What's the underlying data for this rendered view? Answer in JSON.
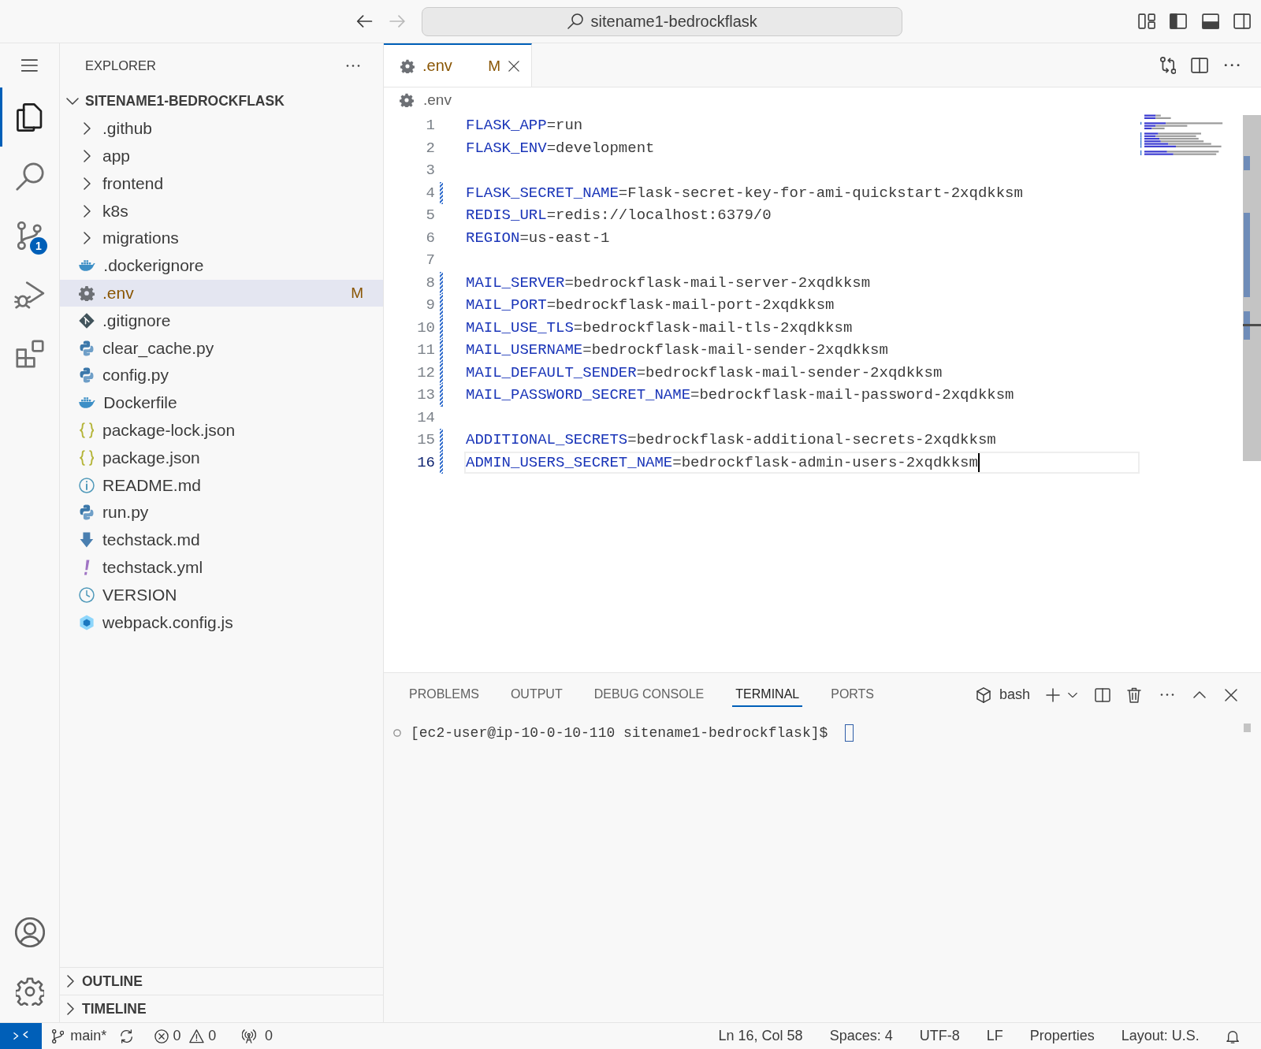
{
  "title_bar": {
    "nav": [
      {
        "kind": "back",
        "disabled": false
      },
      {
        "kind": "forward",
        "disabled": true
      }
    ],
    "search": "sitename1-bedrockflask",
    "layout_toggles": [
      {
        "kind": "primary-sidebar",
        "on": true
      },
      {
        "kind": "panel",
        "on": true
      },
      {
        "kind": "secondary-sidebar",
        "on": false
      }
    ]
  },
  "activity_bar": {
    "items": [
      {
        "kind": "explorer",
        "selected": true
      },
      {
        "kind": "search",
        "selected": false
      },
      {
        "kind": "source-control",
        "selected": false,
        "badge": "1"
      },
      {
        "kind": "run-debug",
        "selected": false
      },
      {
        "kind": "extensions",
        "selected": false
      }
    ]
  },
  "sidebar": {
    "title": "EXPLORER",
    "root": {
      "name": "SITENAME1-BEDROCKFLASK",
      "expanded": true,
      "children": [
        {
          "name": ".github",
          "kind": "folder",
          "expanded": false,
          "selected": false,
          "modified": false
        },
        {
          "name": "app",
          "kind": "folder",
          "expanded": false,
          "selected": false,
          "modified": false
        },
        {
          "name": "frontend",
          "kind": "folder",
          "expanded": false,
          "selected": false,
          "modified": false
        },
        {
          "name": "k8s",
          "kind": "folder",
          "expanded": false,
          "selected": false,
          "modified": false
        },
        {
          "name": "migrations",
          "kind": "folder",
          "expanded": false,
          "selected": false,
          "modified": false
        },
        {
          "name": ".dockerignore",
          "kind": "docker",
          "selected": false,
          "modified": false
        },
        {
          "name": ".env",
          "kind": "config",
          "selected": true,
          "modified": true,
          "badge": "M"
        },
        {
          "name": ".gitignore",
          "kind": "git",
          "selected": false,
          "modified": false
        },
        {
          "name": "clear_cache.py",
          "kind": "python",
          "selected": false,
          "modified": false
        },
        {
          "name": "config.py",
          "kind": "python",
          "selected": false,
          "modified": false
        },
        {
          "name": "Dockerfile",
          "kind": "docker",
          "selected": false,
          "modified": false
        },
        {
          "name": "package-lock.json",
          "kind": "json",
          "selected": false,
          "modified": false
        },
        {
          "name": "package.json",
          "kind": "json",
          "selected": false,
          "modified": false
        },
        {
          "name": "README.md",
          "kind": "info",
          "selected": false,
          "modified": false
        },
        {
          "name": "run.py",
          "kind": "python",
          "selected": false,
          "modified": false
        },
        {
          "name": "techstack.md",
          "kind": "markdown",
          "selected": false,
          "modified": false
        },
        {
          "name": "techstack.yml",
          "kind": "yaml",
          "selected": false,
          "modified": false
        },
        {
          "name": "VERSION",
          "kind": "version",
          "selected": false,
          "modified": false
        },
        {
          "name": "webpack.config.js",
          "kind": "webpack",
          "selected": false,
          "modified": false
        }
      ]
    },
    "sections": [
      {
        "title": "OUTLINE",
        "expanded": false
      },
      {
        "title": "TIMELINE",
        "expanded": false
      }
    ]
  },
  "editor": {
    "tabs": [
      {
        "label": ".env",
        "kind": "config",
        "badge": "M",
        "modified": true,
        "selected": true
      }
    ],
    "breadcrumb": [
      {
        "label": ".env",
        "kind": "config"
      }
    ],
    "lines": [
      {
        "number": "1",
        "key": "FLASK_APP",
        "value": "=run",
        "modified": false,
        "current": false
      },
      {
        "number": "2",
        "key": "FLASK_ENV",
        "value": "=development",
        "modified": false,
        "current": false
      },
      {
        "number": "3",
        "modified": false,
        "current": false
      },
      {
        "number": "4",
        "key": "FLASK_SECRET_NAME",
        "value": "=Flask-secret-key-for-ami-quickstart-2xqdkksm",
        "modified": true,
        "current": false
      },
      {
        "number": "5",
        "key": "REDIS_URL",
        "value": "=redis://localhost:6379/0",
        "modified": false,
        "current": false
      },
      {
        "number": "6",
        "key": "REGION",
        "value": "=us-east-1",
        "modified": false,
        "current": false
      },
      {
        "number": "7",
        "modified": false,
        "current": false
      },
      {
        "number": "8",
        "key": "MAIL_SERVER",
        "value": "=bedrockflask-mail-server-2xqdkksm",
        "modified": true,
        "current": false
      },
      {
        "number": "9",
        "key": "MAIL_PORT",
        "value": "=bedrockflask-mail-port-2xqdkksm",
        "modified": true,
        "current": false
      },
      {
        "number": "10",
        "key": "MAIL_USE_TLS",
        "value": "=bedrockflask-mail-tls-2xqdkksm",
        "modified": true,
        "current": false
      },
      {
        "number": "11",
        "key": "MAIL_USERNAME",
        "value": "=bedrockflask-mail-sender-2xqdkksm",
        "modified": true,
        "current": false
      },
      {
        "number": "12",
        "key": "MAIL_DEFAULT_SENDER",
        "value": "=bedrockflask-mail-sender-2xqdkksm",
        "modified": true,
        "current": false
      },
      {
        "number": "13",
        "key": "MAIL_PASSWORD_SECRET_NAME",
        "value": "=bedrockflask-mail-password-2xqdkksm",
        "modified": true,
        "current": false
      },
      {
        "number": "14",
        "modified": false,
        "current": false
      },
      {
        "number": "15",
        "key": "ADDITIONAL_SECRETS",
        "value": "=bedrockflask-additional-secrets-2xqdkksm",
        "modified": true,
        "current": false
      },
      {
        "number": "16",
        "key": "ADMIN_USERS_SECRET_NAME",
        "value": "=bedrockflask-admin-users-2xqdkksm",
        "modified": true,
        "current": true
      }
    ]
  },
  "panel": {
    "tabs": [
      {
        "label": "PROBLEMS",
        "selected": false
      },
      {
        "label": "OUTPUT",
        "selected": false
      },
      {
        "label": "DEBUG CONSOLE",
        "selected": false
      },
      {
        "label": "TERMINAL",
        "selected": true
      },
      {
        "label": "PORTS",
        "selected": false
      }
    ],
    "shell": "bash",
    "prompt": "[ec2-user@ip-10-0-10-110 sitename1-bedrockflask]$"
  },
  "status_bar": {
    "branch": "main*",
    "errors": "0",
    "warnings": "0",
    "ports": "0",
    "items": [
      "Ln 16, Col 58",
      "Spaces: 4",
      "UTF-8",
      "LF",
      "Properties",
      "Layout: U.S."
    ]
  }
}
